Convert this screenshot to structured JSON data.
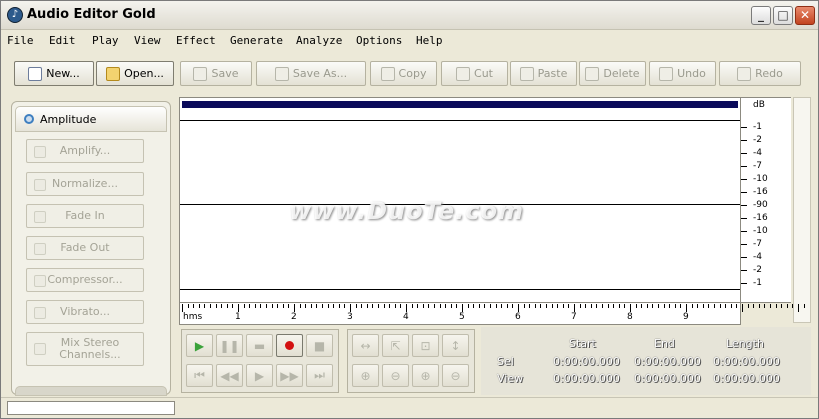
{
  "window": {
    "title": "Audio Editor Gold",
    "icon": "app-icon",
    "controls": [
      "minimize-icon",
      "maximize-icon",
      "close-icon"
    ]
  },
  "menu": [
    "File",
    "Edit",
    "Play",
    "View",
    "Effect",
    "Generate",
    "Analyze",
    "Options",
    "Help"
  ],
  "toolbar": [
    {
      "label": "New...",
      "enabled": true,
      "icon": "new-document-icon"
    },
    {
      "label": "Open...",
      "enabled": true,
      "icon": "open-folder-icon"
    },
    {
      "label": "Save",
      "enabled": false,
      "icon": "save-icon"
    },
    {
      "label": "Save As...",
      "enabled": false,
      "icon": "save-as-icon"
    },
    {
      "label": "Copy",
      "enabled": false,
      "icon": "copy-icon"
    },
    {
      "label": "Cut",
      "enabled": false,
      "icon": "cut-icon"
    },
    {
      "label": "Paste",
      "enabled": false,
      "icon": "paste-icon"
    },
    {
      "label": "Delete",
      "enabled": false,
      "icon": "delete-icon"
    },
    {
      "label": "Undo",
      "enabled": false,
      "icon": "undo-icon"
    },
    {
      "label": "Redo",
      "enabled": false,
      "icon": "redo-icon"
    }
  ],
  "panel": {
    "tab": "Amplitude",
    "buttons": [
      {
        "label": "Amplify..."
      },
      {
        "label": "Normalize..."
      },
      {
        "label": "Fade In"
      },
      {
        "label": "Fade Out"
      },
      {
        "label": "Compressor..."
      },
      {
        "label": "Vibrato..."
      },
      {
        "label": "Mix Stereo Channels..."
      }
    ]
  },
  "db_scale": {
    "unit": "dB",
    "labels": [
      "-1",
      "-2",
      "-4",
      "-7",
      "-10",
      "-16",
      "-90",
      "-16",
      "-10",
      "-7",
      "-4",
      "-2",
      "-1"
    ]
  },
  "ruler": {
    "unit": "hms",
    "labels": [
      "1",
      "2",
      "3",
      "4",
      "5",
      "6",
      "7",
      "8",
      "9"
    ]
  },
  "selection_info": {
    "headers": [
      "Start",
      "End",
      "Length"
    ],
    "rows": [
      {
        "label": "Sel",
        "start": "0:00:00.000",
        "end": "0:00:00.000",
        "length": "0:00:00.000"
      },
      {
        "label": "View",
        "start": "0:00:00.000",
        "end": "0:00:00.000",
        "length": "0:00:00.000"
      }
    ]
  },
  "watermark": "www.DuoTe.com",
  "colors": {
    "waveform_bar": "#0a0a5a",
    "record": "#d31212",
    "play": "#3aa23a"
  }
}
